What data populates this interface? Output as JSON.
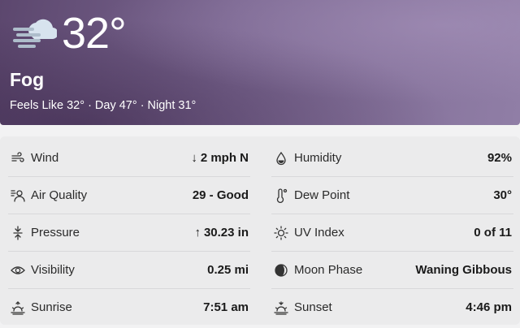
{
  "current": {
    "temperature": "32°",
    "condition": "Fog",
    "condition_icon": "fog-icon",
    "feels_like_line": "Feels Like 32° · Day 47° · Night 31°"
  },
  "details": {
    "left": [
      {
        "key": "wind",
        "icon": "wind-icon",
        "label": "Wind",
        "arrow": "↓",
        "value": "2 mph N"
      },
      {
        "key": "air-quality",
        "icon": "air-quality-icon",
        "label": "Air Quality",
        "arrow": "",
        "value": "29 - Good"
      },
      {
        "key": "pressure",
        "icon": "pressure-icon",
        "label": "Pressure",
        "arrow": "↑",
        "value": "30.23 in"
      },
      {
        "key": "visibility",
        "icon": "eye-icon",
        "label": "Visibility",
        "arrow": "",
        "value": "0.25 mi"
      },
      {
        "key": "sunrise",
        "icon": "sunrise-icon",
        "label": "Sunrise",
        "arrow": "",
        "value": "7:51 am"
      }
    ],
    "right": [
      {
        "key": "humidity",
        "icon": "droplet-icon",
        "label": "Humidity",
        "value": "92%"
      },
      {
        "key": "dew-point",
        "icon": "thermometer-icon",
        "label": "Dew Point",
        "value": "30°"
      },
      {
        "key": "uv-index",
        "icon": "sun-icon",
        "label": "UV Index",
        "value": "0 of 11"
      },
      {
        "key": "moon-phase",
        "icon": "moon-icon",
        "label": "Moon Phase",
        "value": "Waning Gibbous"
      },
      {
        "key": "sunset",
        "icon": "sunset-icon",
        "label": "Sunset",
        "value": "4:46 pm"
      }
    ]
  }
}
